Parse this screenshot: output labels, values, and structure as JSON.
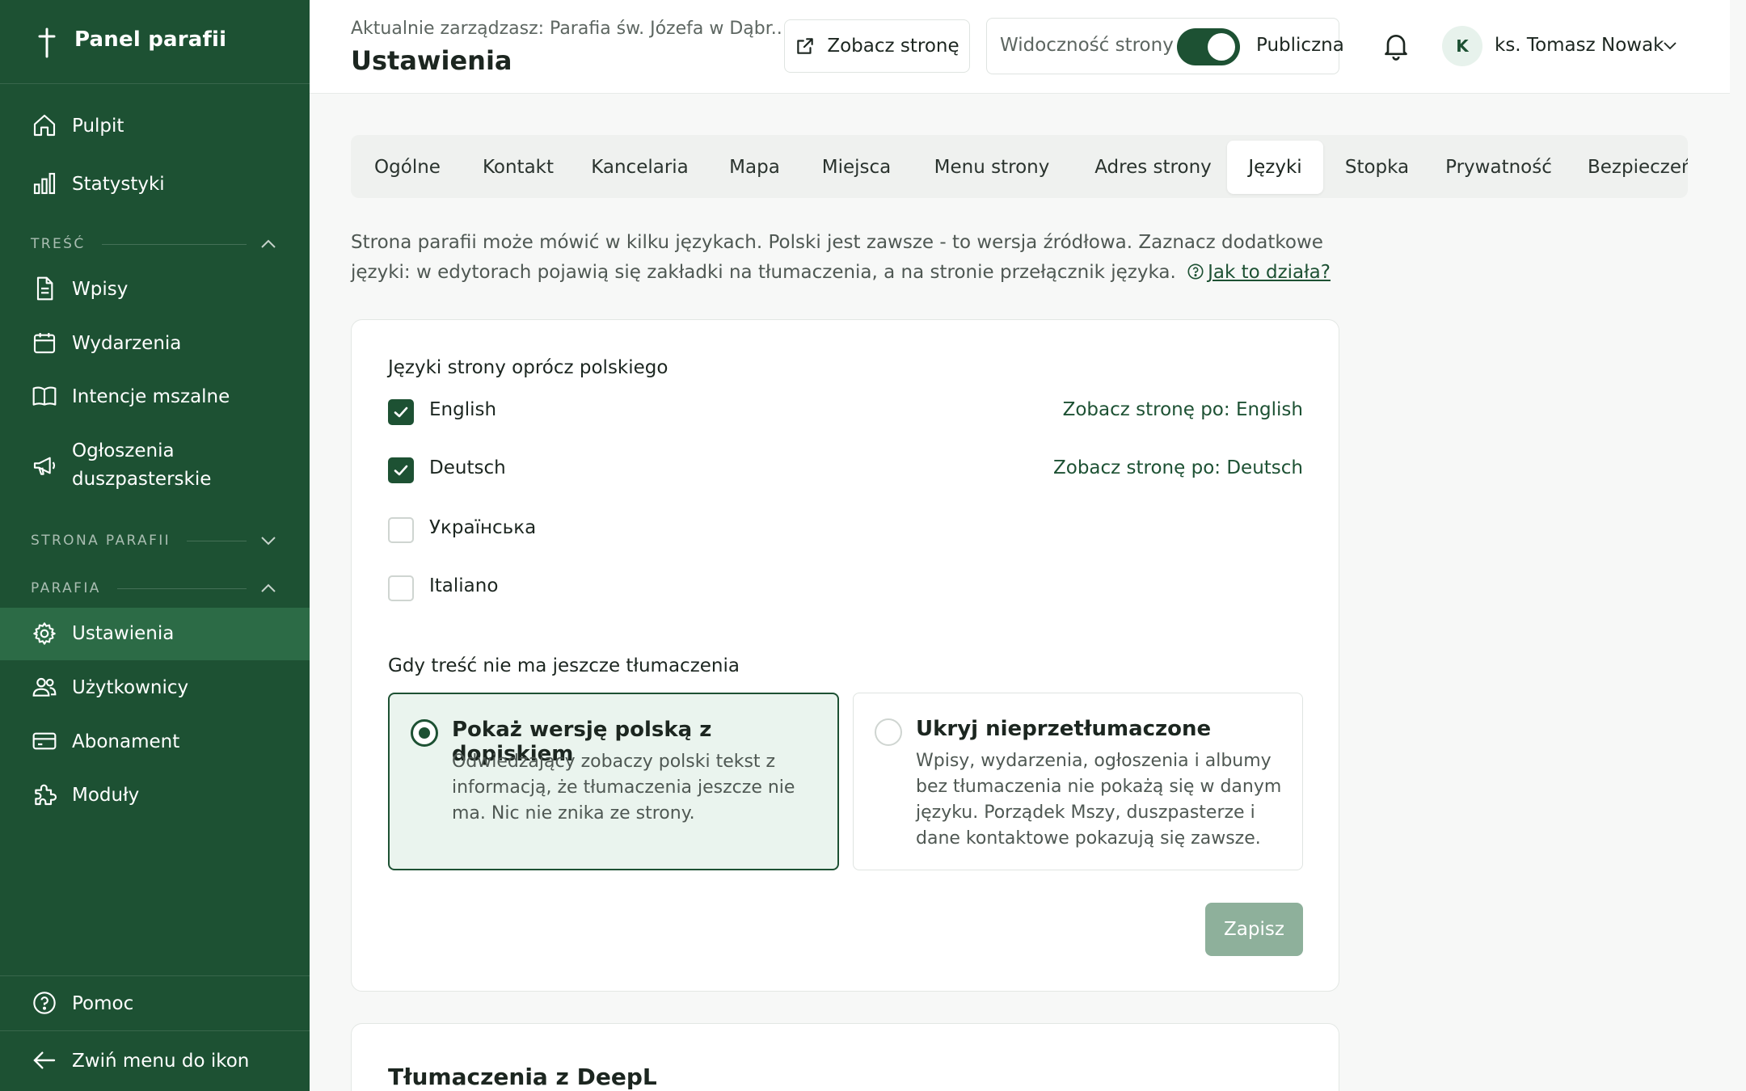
{
  "sidebar": {
    "brand_title": "Panel parafii",
    "top_items": [
      {
        "label": "Pulpit",
        "icon": "home-icon"
      },
      {
        "label": "Statystyki",
        "icon": "bar-chart-icon"
      }
    ],
    "sections": {
      "content": {
        "label": "TREŚĆ",
        "expanded": true
      },
      "site": {
        "label": "STRONA PARAFII",
        "expanded": false
      },
      "parish": {
        "label": "PARAFIA",
        "expanded": true
      }
    },
    "content_items": [
      {
        "label": "Wpisy",
        "icon": "document-icon"
      },
      {
        "label": "Wydarzenia",
        "icon": "calendar-icon"
      },
      {
        "label": "Intencje mszalne",
        "icon": "book-icon"
      },
      {
        "label_line1": "Ogłoszenia",
        "label_line2": "duszpasterskie",
        "icon": "megaphone-icon"
      }
    ],
    "parish_items": [
      {
        "label": "Ustawienia",
        "icon": "gear-icon",
        "active": true
      },
      {
        "label": "Użytkownicy",
        "icon": "users-icon"
      },
      {
        "label": "Abonament",
        "icon": "credit-card-icon"
      },
      {
        "label": "Moduły",
        "icon": "puzzle-icon"
      }
    ],
    "bottom_items": [
      {
        "label": "Pomoc",
        "icon": "help-circle-icon"
      },
      {
        "label": "Zwiń menu do ikon",
        "icon": "arrow-left-icon"
      }
    ]
  },
  "topbar": {
    "breadcrumb": "Aktualnie zarządzasz: Parafia św. Józefa w Dąbr...",
    "page_title": "Ustawienia",
    "view_site_label": "Zobacz stronę",
    "visibility_label": "Widoczność strony",
    "visibility_state": "Publiczna",
    "visibility_on": true,
    "user_initial": "K",
    "user_name": "ks. Tomasz Nowak"
  },
  "tabs": [
    {
      "label": "Ogólne"
    },
    {
      "label": "Kontakt"
    },
    {
      "label": "Kancelaria"
    },
    {
      "label": "Mapa"
    },
    {
      "label": "Miejsca"
    },
    {
      "label": "Menu strony"
    },
    {
      "label": "Adres strony"
    },
    {
      "label": "Języki",
      "active": true
    },
    {
      "label": "Stopka"
    },
    {
      "label": "Prywatność"
    },
    {
      "label": "Bezpieczeństwo"
    }
  ],
  "intro": {
    "text": "Strona parafii może mówić w kilku językach. Polski jest zawsze - to wersja źródłowa. Zaznacz dodatkowe języki: w edytorach pojawią się zakładki na tłumaczenia, a na stronie przełącznik języka.",
    "help_link": "Jak to działa?"
  },
  "languages": {
    "title": "Języki strony oprócz polskiego",
    "items": [
      {
        "name": "English",
        "checked": true,
        "link": "Zobacz stronę po: English"
      },
      {
        "name": "Deutsch",
        "checked": true,
        "link": "Zobacz stronę po: Deutsch"
      },
      {
        "name": "Українська",
        "checked": false,
        "link": ""
      },
      {
        "name": "Italiano",
        "checked": false,
        "link": ""
      }
    ]
  },
  "fallback": {
    "title": "Gdy treść nie ma jeszcze tłumaczenia",
    "options": [
      {
        "title": "Pokaż wersję polską z dopiskiem",
        "desc": "Odwiedzający zobaczy polski tekst z informacją, że tłumaczenia jeszcze nie ma. Nic nie znika ze strony.",
        "selected": true
      },
      {
        "title": "Ukryj nieprzetłumaczone",
        "desc": "Wpisy, wydarzenia, ogłoszenia i albumy bez tłumaczenia nie pokażą się w danym języku. Porządek Mszy, duszpasterze i dane kontaktowe pokazują się zawsze.",
        "selected": false
      }
    ]
  },
  "save_label": "Zapisz",
  "deepl": {
    "title": "Tłumaczenia z DeepL"
  },
  "colors": {
    "brand": "#1d5133",
    "active_nav": "#2c6b46",
    "selected_option_bg": "#eaf4ee",
    "save_disabled": "#8eb09b"
  }
}
